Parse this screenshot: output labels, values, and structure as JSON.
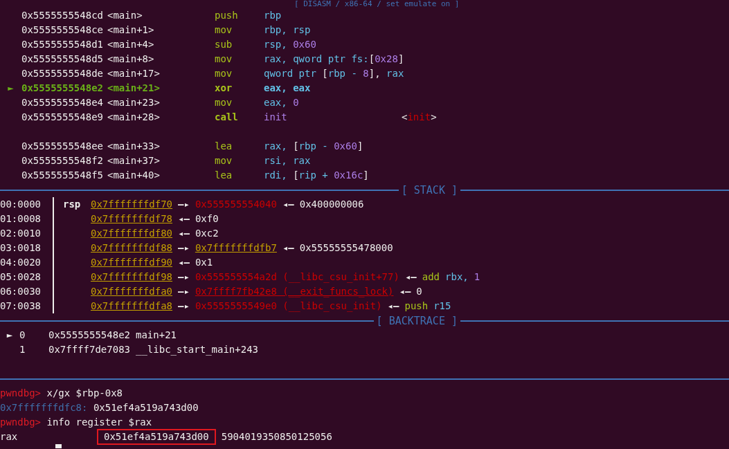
{
  "disasm": {
    "header": "[ DISASM / x86-64 / set emulate on ]",
    "rows": [
      {
        "current": false,
        "address": "0x5555555548cd",
        "symbol": "<main>",
        "mnemonic": "push",
        "operands": [
          {
            "text": "rbp",
            "kind": "register"
          }
        ]
      },
      {
        "current": false,
        "address": "0x5555555548ce",
        "symbol": "<main+1>",
        "mnemonic": "mov",
        "operands": [
          {
            "text": "rbp, rsp",
            "kind": "register"
          }
        ]
      },
      {
        "current": false,
        "address": "0x5555555548d1",
        "symbol": "<main+4>",
        "mnemonic": "sub",
        "operands": [
          {
            "text": "rsp, ",
            "kind": "register"
          },
          {
            "text": "0x60",
            "kind": "number"
          }
        ]
      },
      {
        "current": false,
        "address": "0x5555555548d5",
        "symbol": "<main+8>",
        "mnemonic": "mov",
        "operands": [
          {
            "text": "rax, qword ptr fs:",
            "kind": "register"
          },
          {
            "text": "[",
            "kind": "plain"
          },
          {
            "text": "0x28",
            "kind": "number"
          },
          {
            "text": "]",
            "kind": "plain"
          }
        ]
      },
      {
        "current": false,
        "address": "0x5555555548de",
        "symbol": "<main+17>",
        "mnemonic": "mov",
        "operands": [
          {
            "text": "qword ptr ",
            "kind": "register"
          },
          {
            "text": "[",
            "kind": "plain"
          },
          {
            "text": "rbp - ",
            "kind": "register"
          },
          {
            "text": "8",
            "kind": "number"
          },
          {
            "text": "], ",
            "kind": "plain"
          },
          {
            "text": "rax",
            "kind": "register"
          }
        ]
      },
      {
        "current": true,
        "marker": "►",
        "address": "0x5555555548e2",
        "symbol": "<main+21>",
        "mnemonic": "xor",
        "operands": [
          {
            "text": "eax, eax",
            "kind": "register"
          }
        ]
      },
      {
        "current": false,
        "address": "0x5555555548e4",
        "symbol": "<main+23>",
        "mnemonic": "mov",
        "operands": [
          {
            "text": "eax, ",
            "kind": "register"
          },
          {
            "text": "0",
            "kind": "number"
          }
        ]
      },
      {
        "current": false,
        "address": "0x5555555548e9",
        "symbol": "<main+28>",
        "mnemonic": "call",
        "mnemonic_bold": true,
        "operands": [
          {
            "text": "init",
            "kind": "number"
          }
        ],
        "comment": [
          {
            "text": "<",
            "kind": "plain"
          },
          {
            "text": "init",
            "kind": "code"
          },
          {
            "text": ">",
            "kind": "plain"
          }
        ]
      },
      {
        "kind": "blank"
      },
      {
        "current": false,
        "address": "0x5555555548ee",
        "symbol": "<main+33>",
        "mnemonic": "lea",
        "operands": [
          {
            "text": "rax, ",
            "kind": "register"
          },
          {
            "text": "[",
            "kind": "plain"
          },
          {
            "text": "rbp - ",
            "kind": "register"
          },
          {
            "text": "0x60",
            "kind": "number"
          },
          {
            "text": "]",
            "kind": "plain"
          }
        ]
      },
      {
        "current": false,
        "address": "0x5555555548f2",
        "symbol": "<main+37>",
        "mnemonic": "mov",
        "operands": [
          {
            "text": "rsi, rax",
            "kind": "register"
          }
        ]
      },
      {
        "current": false,
        "address": "0x5555555548f5",
        "symbol": "<main+40>",
        "mnemonic": "lea",
        "operands": [
          {
            "text": "rdi, ",
            "kind": "register"
          },
          {
            "text": "[",
            "kind": "plain"
          },
          {
            "text": "rip + ",
            "kind": "register"
          },
          {
            "text": "0x16c",
            "kind": "number"
          },
          {
            "text": "]",
            "kind": "plain"
          }
        ]
      }
    ]
  },
  "stack": {
    "title": "[ STACK ]",
    "rows": [
      {
        "offset": "00:0000",
        "register": "rsp",
        "segments": [
          {
            "text": "0x7fffffffdf70",
            "kind": "stack"
          },
          {
            "text": "—▸",
            "kind": "arrow"
          },
          {
            "text": "0x555555554040",
            "kind": "code"
          },
          {
            "text": "◂—",
            "kind": "arrow"
          },
          {
            "text": "0x400000006",
            "kind": "plain"
          }
        ]
      },
      {
        "offset": "01:0008",
        "segments": [
          {
            "text": "0x7fffffffdf78",
            "kind": "stack"
          },
          {
            "text": "◂—",
            "kind": "arrow"
          },
          {
            "text": "0xf0",
            "kind": "plain"
          }
        ]
      },
      {
        "offset": "02:0010",
        "segments": [
          {
            "text": "0x7fffffffdf80",
            "kind": "stack"
          },
          {
            "text": "◂—",
            "kind": "arrow"
          },
          {
            "text": "0xc2",
            "kind": "plain"
          }
        ]
      },
      {
        "offset": "03:0018",
        "segments": [
          {
            "text": "0x7fffffffdf88",
            "kind": "stack"
          },
          {
            "text": "—▸",
            "kind": "arrow"
          },
          {
            "text": "0x7fffffffdfb7",
            "kind": "stack"
          },
          {
            "text": "◂—",
            "kind": "arrow"
          },
          {
            "text": "0x55555555478000",
            "kind": "plain"
          }
        ]
      },
      {
        "offset": "04:0020",
        "segments": [
          {
            "text": "0x7fffffffdf90",
            "kind": "stack"
          },
          {
            "text": "◂—",
            "kind": "arrow"
          },
          {
            "text": "0x1",
            "kind": "plain"
          }
        ]
      },
      {
        "offset": "05:0028",
        "segments": [
          {
            "text": "0x7fffffffdf98",
            "kind": "stack"
          },
          {
            "text": "—▸",
            "kind": "arrow"
          },
          {
            "text": "0x555555554a2d (__libc_csu_init+77)",
            "kind": "code"
          },
          {
            "text": "◂—",
            "kind": "arrow"
          },
          {
            "text": "add",
            "kind": "mnemonic"
          },
          {
            "text": "rbx,",
            "kind": "register"
          },
          {
            "text": "1",
            "kind": "number"
          }
        ]
      },
      {
        "offset": "06:0030",
        "segments": [
          {
            "text": "0x7fffffffdfa0",
            "kind": "stack"
          },
          {
            "text": "—▸",
            "kind": "arrow"
          },
          {
            "text": "0x7ffff7fb42e8 (__exit_funcs_lock)",
            "kind": "data"
          },
          {
            "text": "◂—",
            "kind": "arrow"
          },
          {
            "text": "0",
            "kind": "plain"
          }
        ]
      },
      {
        "offset": "07:0038",
        "segments": [
          {
            "text": "0x7fffffffdfa8",
            "kind": "stack"
          },
          {
            "text": "—▸",
            "kind": "arrow"
          },
          {
            "text": "0x5555555549e0 (__libc_csu_init)",
            "kind": "code"
          },
          {
            "text": "◂—",
            "kind": "arrow"
          },
          {
            "text": "push",
            "kind": "mnemonic"
          },
          {
            "text": "r15",
            "kind": "register"
          }
        ]
      }
    ]
  },
  "backtrace": {
    "title": "[ BACKTRACE ]",
    "frames": [
      {
        "marker": "►",
        "index": "0",
        "address": "0x5555555548e2",
        "symbol": "main+21"
      },
      {
        "index": "1",
        "address": "0x7ffff7de7083",
        "symbol": "__libc_start_main+243"
      }
    ]
  },
  "console": {
    "lines": [
      {
        "kind": "command",
        "prompt": "pwndbg>",
        "command": "x/gx $rbp-0x8"
      },
      {
        "kind": "memory",
        "address": "0x7fffffffdfc8:",
        "value": "0x51ef4a519a743d00"
      },
      {
        "kind": "command",
        "prompt": "pwndbg>",
        "command": "info register $rax"
      },
      {
        "kind": "register",
        "name": "rax",
        "value": "0x51ef4a519a743d00",
        "highlighted": true,
        "decimal": "5904019350850125056"
      }
    ],
    "cursor": true
  }
}
